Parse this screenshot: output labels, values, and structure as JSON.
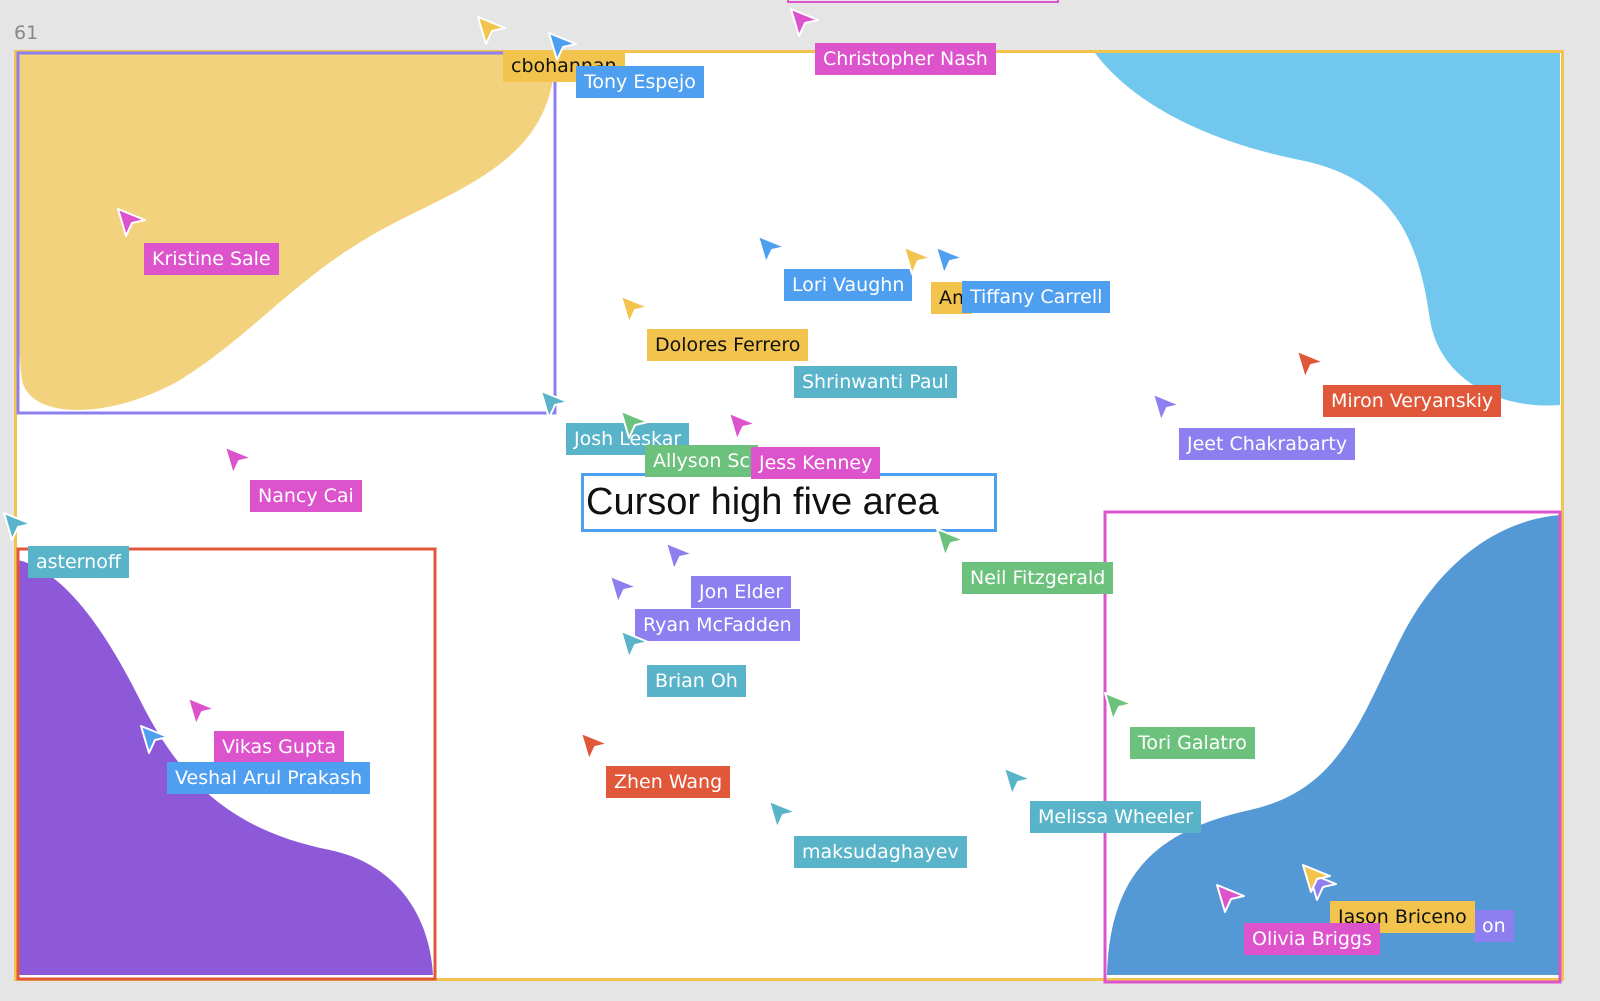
{
  "frame": {
    "name": "61",
    "title_text": "Cursor high five area"
  },
  "colors": {
    "yellow": "#f2c44e",
    "blue": "#4f9ff0",
    "pink": "#dc53cc",
    "teal": "#5ab4c9",
    "green": "#6cc27c",
    "purple": "#8e7ff0",
    "red": "#e0573a",
    "frame_border": "#f2c44e"
  },
  "cursors": [
    {
      "name": "cbohannan",
      "color": "#f2c44e"
    },
    {
      "name": "Tony Espejo",
      "color": "#4f9ff0"
    },
    {
      "name": "Christopher Nash",
      "color": "#dc53cc"
    },
    {
      "name": "Kristine Sale",
      "color": "#dc53cc"
    },
    {
      "name": "Lori Vaughn",
      "color": "#4f9ff0"
    },
    {
      "name": "An",
      "color": "#f2c44e"
    },
    {
      "name": "Tiffany Carrell",
      "color": "#4f9ff0"
    },
    {
      "name": "Dolores Ferrero",
      "color": "#f2c44e"
    },
    {
      "name": "Shrinwanti Paul",
      "color": "#5ab4c9"
    },
    {
      "name": "Miron Veryanskiy",
      "color": "#e0573a"
    },
    {
      "name": "Jeet Chakrabarty",
      "color": "#8e7ff0"
    },
    {
      "name": "Josh Leskar",
      "color": "#5ab4c9"
    },
    {
      "name": "Allyson Sc",
      "color": "#6cc27c"
    },
    {
      "name": "Jess Kenney",
      "color": "#dc53cc"
    },
    {
      "name": "Nancy Cai",
      "color": "#dc53cc"
    },
    {
      "name": "asternoff",
      "color": "#5ab4c9"
    },
    {
      "name": "Neil Fitzgerald",
      "color": "#6cc27c"
    },
    {
      "name": "Jon Elder",
      "color": "#8e7ff0"
    },
    {
      "name": "Ryan McFadden",
      "color": "#8e7ff0"
    },
    {
      "name": "Brian Oh",
      "color": "#5ab4c9"
    },
    {
      "name": "Vikas Gupta",
      "color": "#dc53cc"
    },
    {
      "name": "Veshal Arul Prakash",
      "color": "#4f9ff0"
    },
    {
      "name": "Zhen Wang",
      "color": "#e0573a"
    },
    {
      "name": "Tori Galatro",
      "color": "#6cc27c"
    },
    {
      "name": "Melissa Wheeler",
      "color": "#5ab4c9"
    },
    {
      "name": "maksudaghayev",
      "color": "#5ab4c9"
    },
    {
      "name": "on",
      "color": "#8e7ff0"
    },
    {
      "name": "Jason Briceno",
      "color": "#f2c44e"
    },
    {
      "name": "Olivia Briggs",
      "color": "#dc53cc"
    }
  ]
}
